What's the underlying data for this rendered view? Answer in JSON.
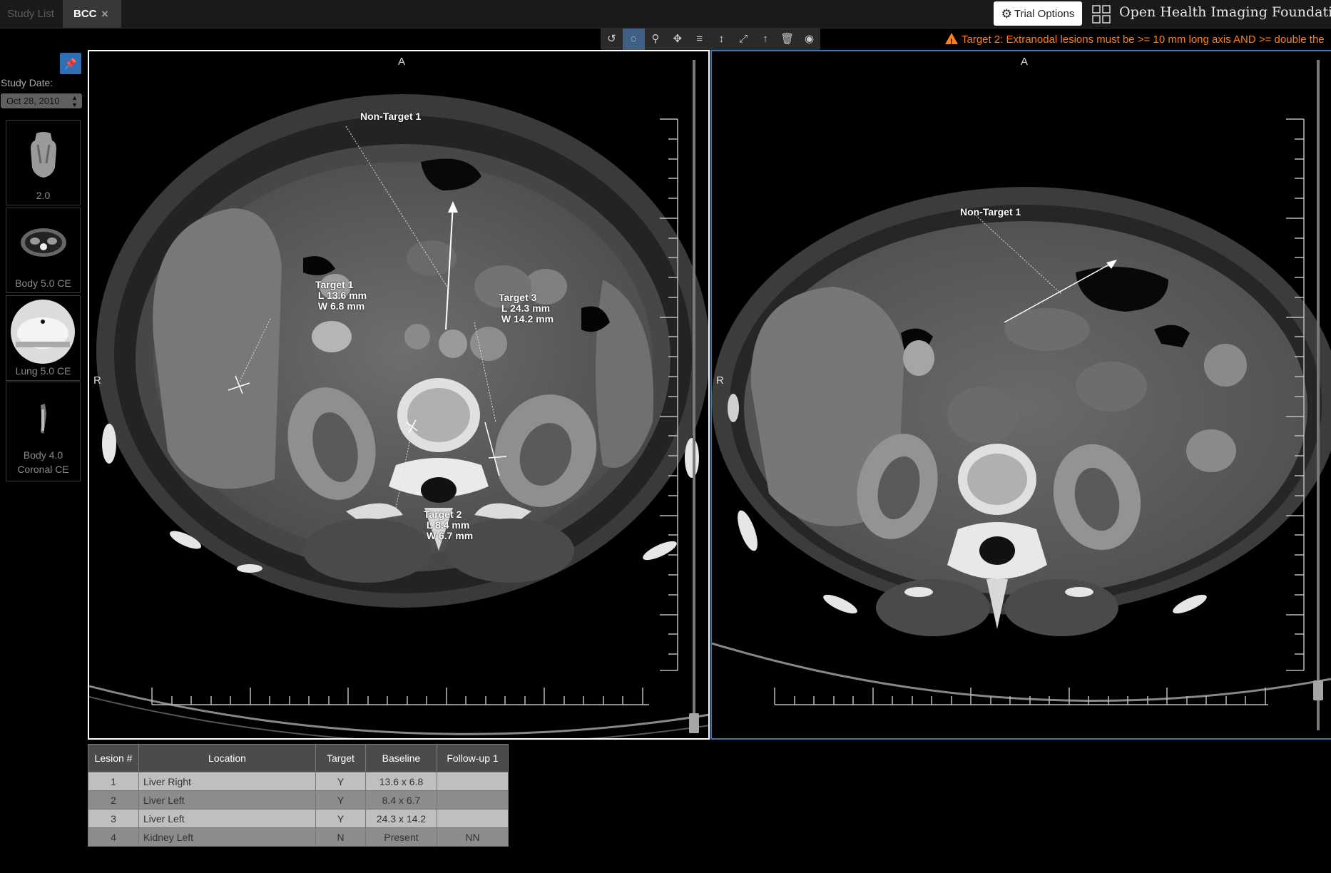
{
  "tabs": {
    "study_list": "Study List",
    "active": "BCC",
    "close_glyph": "×"
  },
  "header": {
    "trial_options": "Trial Options",
    "brand": "Open Health Imaging Foundation"
  },
  "toolbar": {
    "tools": [
      {
        "name": "rotate-icon",
        "glyph": "↺"
      },
      {
        "name": "window-level-icon",
        "glyph": "◌"
      },
      {
        "name": "zoom-icon",
        "glyph": "⚲"
      },
      {
        "name": "pan-icon",
        "glyph": "✥"
      },
      {
        "name": "stack-scroll-icon",
        "glyph": "≡"
      },
      {
        "name": "length-icon",
        "glyph": "↕"
      },
      {
        "name": "fullscreen-icon",
        "glyph": "⤢"
      },
      {
        "name": "arrow-annotate-icon",
        "glyph": "↑"
      },
      {
        "name": "trash-icon",
        "glyph": "🗑"
      },
      {
        "name": "eye-icon",
        "glyph": "◉"
      }
    ]
  },
  "warning": {
    "text": "Target 2: Extranodal lesions must be >= 10 mm long axis AND >= double the"
  },
  "sidebar": {
    "study_date_label": "Study Date:",
    "study_date_value": "Oct 28, 2010",
    "series": [
      {
        "label": "2.0"
      },
      {
        "label": "Body 5.0 CE"
      },
      {
        "label": "Lung 5.0 CE"
      },
      {
        "label_line1": "Body 4.0",
        "label_line2": "Coronal CE"
      }
    ]
  },
  "viewport1": {
    "orientation_top": "A",
    "orientation_left": "R",
    "annotations": {
      "non_target_1": "Non-Target 1",
      "target_1": "Target 1\n L 13.6 mm\n W 6.8 mm",
      "target_2": "Target 2\n L 8.4 mm\n W 6.7 mm",
      "target_3": "Target 3\n L 24.3 mm\n W 14.2 mm"
    }
  },
  "viewport2": {
    "orientation_top": "A",
    "orientation_left": "R",
    "annotations": {
      "non_target_1": "Non-Target 1"
    }
  },
  "lesion_table": {
    "headers": [
      "Lesion #",
      "Location",
      "Target",
      "Baseline",
      "Follow-up 1"
    ],
    "rows": [
      {
        "num": "1",
        "location": "Liver Right",
        "target": "Y",
        "baseline": "13.6 x 6.8",
        "followup": ""
      },
      {
        "num": "2",
        "location": "Liver Left",
        "target": "Y",
        "baseline": "8.4 x 6.7",
        "followup": ""
      },
      {
        "num": "3",
        "location": "Liver Left",
        "target": "Y",
        "baseline": "24.3 x 14.2",
        "followup": ""
      },
      {
        "num": "4",
        "location": "Kidney Left",
        "target": "N",
        "baseline": "Present",
        "followup": "NN"
      }
    ]
  },
  "colors": {
    "accent": "#3a78b8",
    "warning": "#ff7f1a",
    "active_tool": "#3f5f84"
  }
}
